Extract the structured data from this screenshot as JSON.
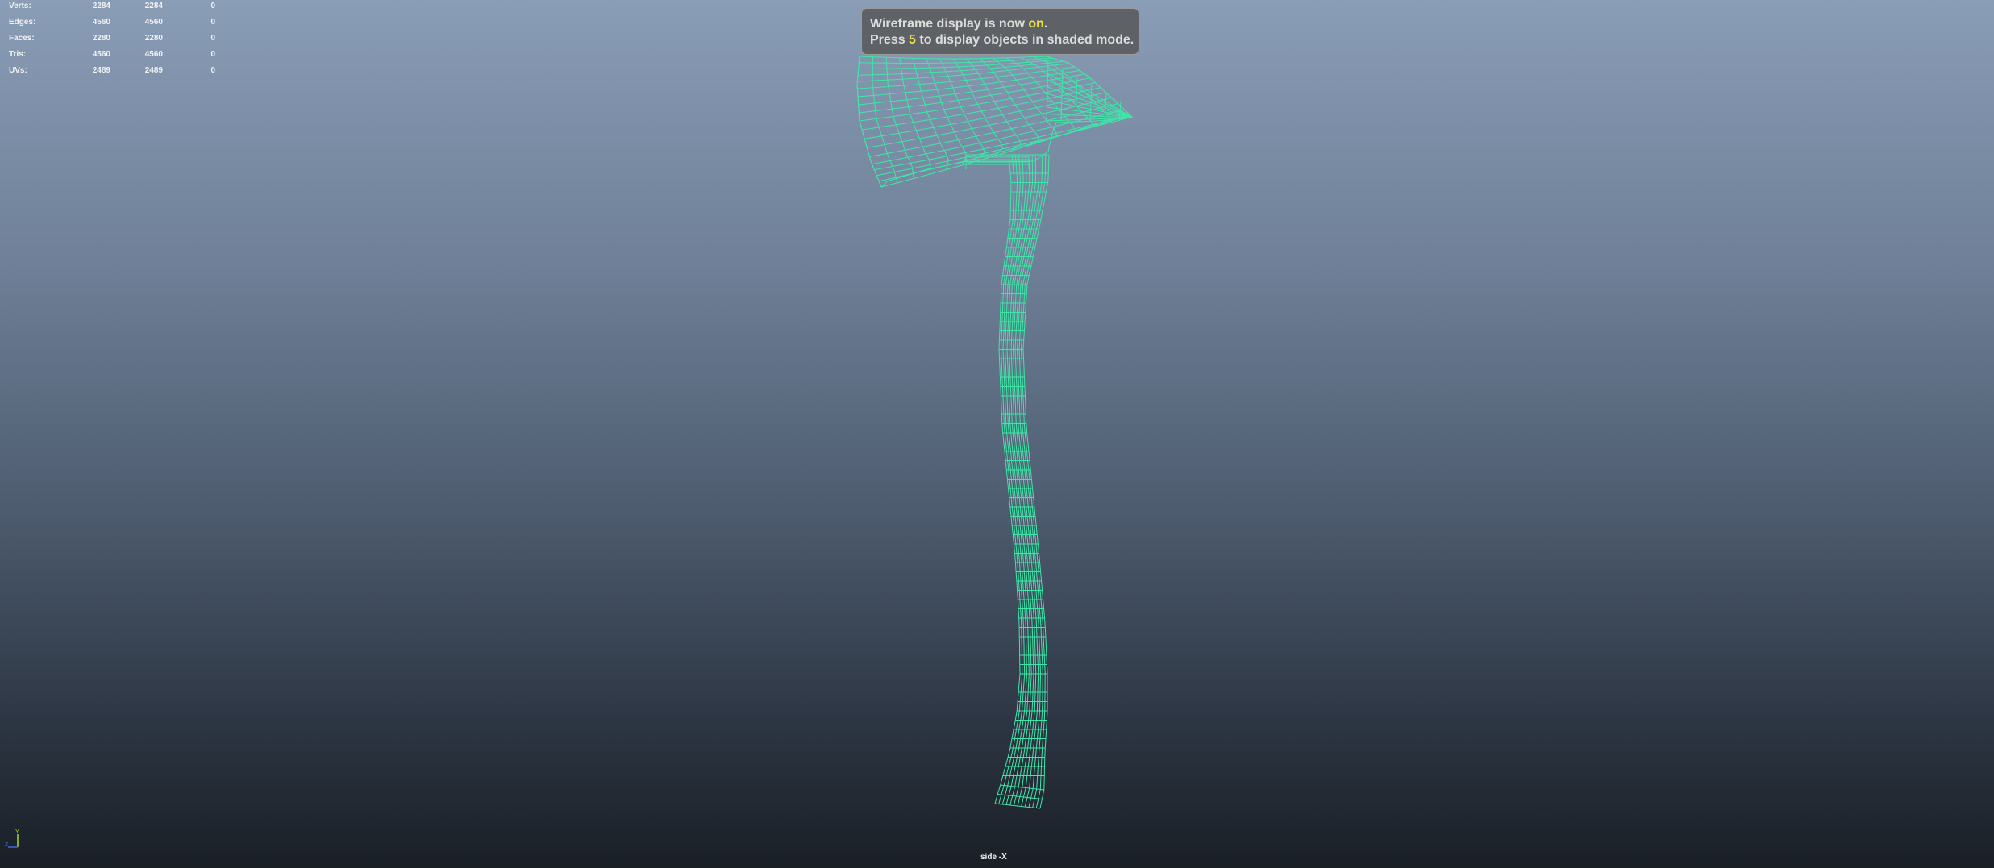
{
  "hud": {
    "rows": [
      {
        "label": "Verts:",
        "c1": "2284",
        "c2": "2284",
        "c3": "0"
      },
      {
        "label": "Edges:",
        "c1": "4560",
        "c2": "4560",
        "c3": "0"
      },
      {
        "label": "Faces:",
        "c1": "2280",
        "c2": "2280",
        "c3": "0"
      },
      {
        "label": "Tris:",
        "c1": "4560",
        "c2": "4560",
        "c3": "0"
      },
      {
        "label": "UVs:",
        "c1": "2489",
        "c2": "2489",
        "c3": "0"
      }
    ]
  },
  "message": {
    "line1_pre": "Wireframe display is now ",
    "line1_hl": "on",
    "line1_post": ".",
    "line2_pre": "Press ",
    "line2_hl": "5",
    "line2_post": " to display objects in shaded mode."
  },
  "camera_label": "side -X",
  "axis": {
    "y": "Y",
    "z": "Z"
  },
  "colors": {
    "wireframe": "#3fe6a8",
    "highlight": "#f2e04a",
    "axis_y": "#a4d43a",
    "axis_z": "#3a64e0"
  }
}
